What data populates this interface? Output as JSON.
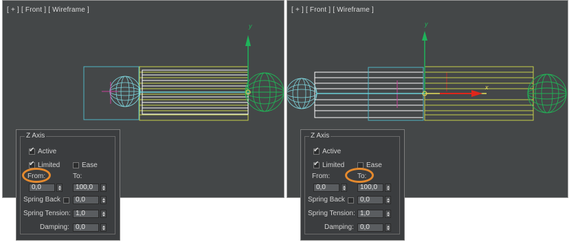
{
  "viewports": [
    {
      "label": {
        "plus": "[ + ]",
        "view": "[ Front ]",
        "mode": "[ Wireframe ]"
      },
      "axis_y": "y",
      "axis_x": ""
    },
    {
      "label": {
        "plus": "[ + ]",
        "view": "[ Front ]",
        "mode": "[ Wireframe ]"
      },
      "axis_y": "y",
      "axis_x": "x"
    }
  ],
  "panels": [
    {
      "group_title": "Z Axis",
      "active_label": "Active",
      "active_checked": true,
      "limited_label": "Limited",
      "limited_checked": true,
      "ease_label": "Ease",
      "ease_checked": false,
      "from_label": "From:",
      "to_label": "To:",
      "from_value": "0,0",
      "to_value": "100,0",
      "spring_back_label": "Spring Back",
      "spring_back_checked": false,
      "spring_back_value": "0,0",
      "spring_tension_label": "Spring Tension:",
      "spring_tension_value": "1,0",
      "damping_label": "Damping:",
      "damping_value": "0,0",
      "highlighted": "from"
    },
    {
      "group_title": "Z Axis",
      "active_label": "Active",
      "active_checked": true,
      "limited_label": "Limited",
      "limited_checked": true,
      "ease_label": "Ease",
      "ease_checked": false,
      "from_label": "From:",
      "to_label": "To:",
      "from_value": "0,0",
      "to_value": "100,0",
      "spring_back_label": "Spring Back",
      "spring_back_checked": false,
      "spring_back_value": "0,0",
      "spring_tension_label": "Spring Tension:",
      "spring_tension_value": "1,0",
      "damping_label": "Damping:",
      "damping_value": "0,0",
      "highlighted": "to"
    }
  ],
  "colors": {
    "viewport_bg": "#444748",
    "bone_white": "#ffffff",
    "bone_yellow": "#c8d24a",
    "sphere_cyan": "#7fd8e0",
    "sphere_green": "#21b356",
    "gizmo_green": "#1fb35a",
    "gizmo_red": "#e0261b",
    "highlight_orange": "#e58a2e"
  }
}
